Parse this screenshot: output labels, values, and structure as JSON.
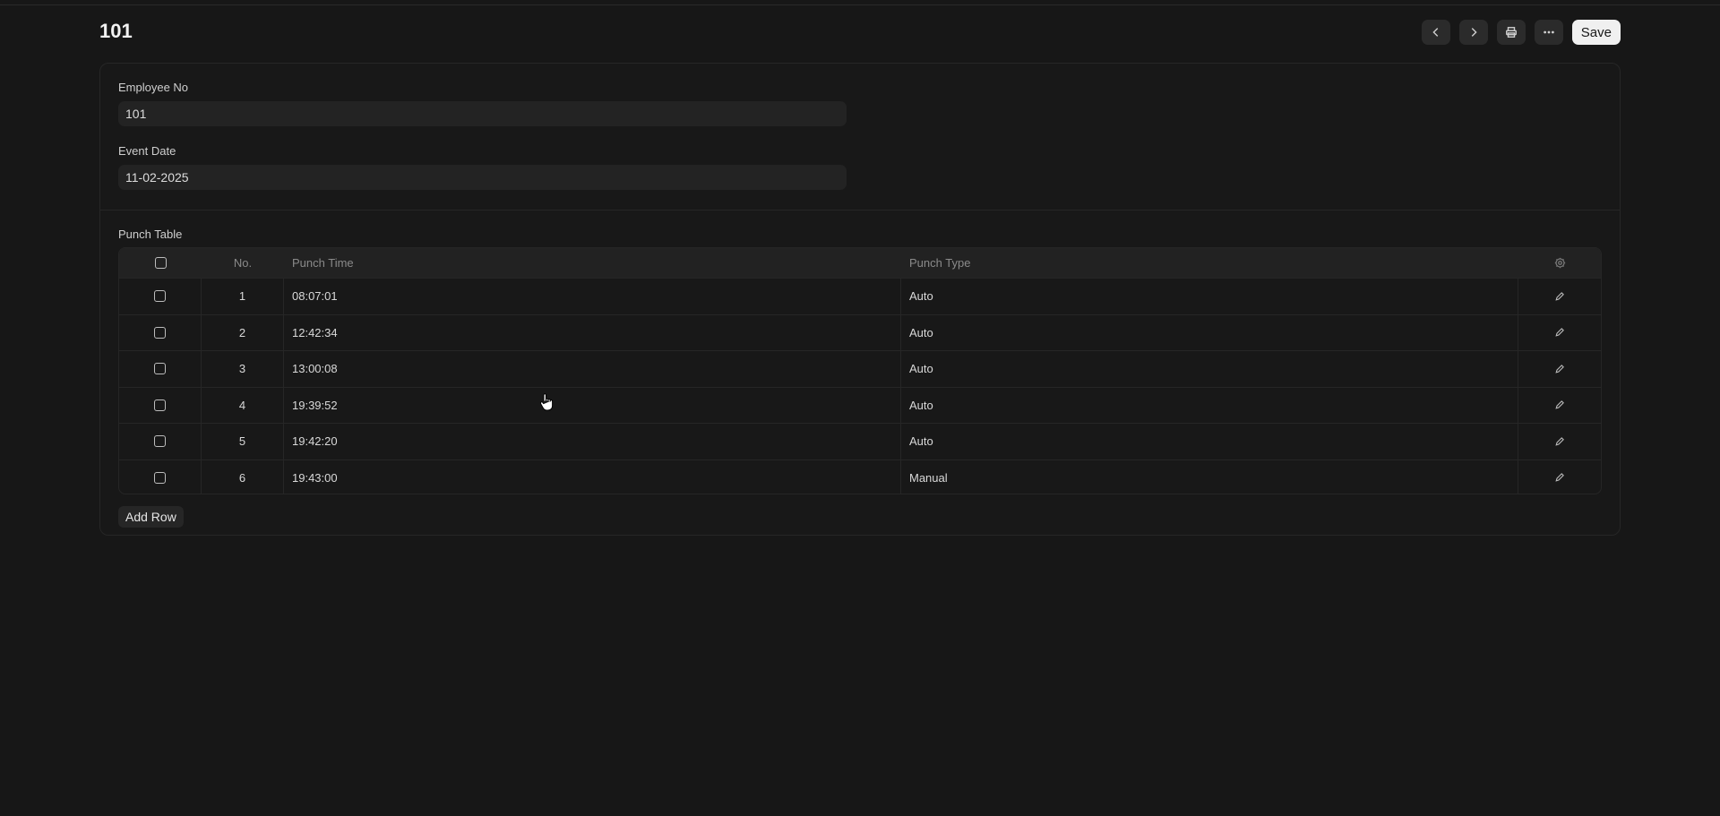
{
  "header": {
    "title": "101",
    "prev_icon": "chevron-left-icon",
    "next_icon": "chevron-right-icon",
    "print_icon": "printer-icon",
    "more_icon": "more-horizontal-icon",
    "save_label": "Save"
  },
  "form": {
    "employee_no": {
      "label": "Employee No",
      "value": "101"
    },
    "event_date": {
      "label": "Event Date",
      "value": "11-02-2025"
    }
  },
  "punch_table": {
    "label": "Punch Table",
    "columns": {
      "no": "No.",
      "time": "Punch Time",
      "type": "Punch Type"
    },
    "rows": [
      {
        "no": "1",
        "time": "08:07:01",
        "type": "Auto"
      },
      {
        "no": "2",
        "time": "12:42:34",
        "type": "Auto"
      },
      {
        "no": "3",
        "time": "13:00:08",
        "type": "Auto"
      },
      {
        "no": "4",
        "time": "19:39:52",
        "type": "Auto"
      },
      {
        "no": "5",
        "time": "19:42:20",
        "type": "Auto"
      },
      {
        "no": "6",
        "time": "19:43:00",
        "type": "Manual"
      }
    ],
    "add_row_label": "Add Row"
  },
  "colors": {
    "background": "#171717",
    "card": "#181818",
    "input": "#232323",
    "save_button": "#f0f0f0"
  }
}
